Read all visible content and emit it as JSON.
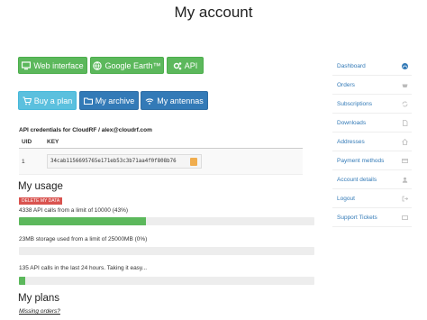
{
  "page": {
    "title": "My account"
  },
  "nav_buttons": [
    {
      "label": "Web interface",
      "icon": "monitor-icon"
    },
    {
      "label": "Google Earth™",
      "icon": "globe-icon"
    },
    {
      "label": "API",
      "icon": "gears-icon"
    }
  ],
  "action_buttons": [
    {
      "label": "Buy a plan",
      "icon": "cart-icon"
    },
    {
      "label": "My archive",
      "icon": "folder-icon"
    },
    {
      "label": "My antennas",
      "icon": "wifi-icon"
    }
  ],
  "api_credentials": {
    "title": "API credentials for CloudRF / alex@cloudrf.com",
    "columns": [
      "UID",
      "KEY"
    ],
    "rows": [
      {
        "uid": "1",
        "key": "34cab1156695765e171eb53c3b71aa4f0f808b76"
      }
    ]
  },
  "usage": {
    "heading": "My usage",
    "delete_button": "DELETE MY DATA",
    "api_calls_text": "4338 API calls from a limit of 10000 (43%)",
    "api_calls_fraction": 0.43,
    "storage_text": "23MB storage used from a limit of 25000MB (0%)",
    "storage_fraction": 0.0,
    "last24_text": "135 API calls in the last 24 hours. Taking it easy...",
    "last24_fraction": 0.02
  },
  "plans": {
    "heading": "My plans",
    "missing_orders_link": "Missing orders?"
  },
  "sidebar": {
    "items": [
      {
        "label": "Dashboard",
        "icon": "dashboard-icon",
        "active": true
      },
      {
        "label": "Orders",
        "icon": "basket-icon"
      },
      {
        "label": "Subscriptions",
        "icon": "refresh-icon"
      },
      {
        "label": "Downloads",
        "icon": "file-icon"
      },
      {
        "label": "Addresses",
        "icon": "home-icon"
      },
      {
        "label": "Payment methods",
        "icon": "card-icon"
      },
      {
        "label": "Account details",
        "icon": "user-icon"
      },
      {
        "label": "Logout",
        "icon": "logout-icon"
      },
      {
        "label": "Support Tickets",
        "icon": "ticket-icon"
      }
    ]
  },
  "colors": {
    "green": "#5cb85c",
    "blue": "#337ab7",
    "light_blue": "#5bc0de",
    "danger": "#d9534f",
    "link": "#337ab7"
  }
}
